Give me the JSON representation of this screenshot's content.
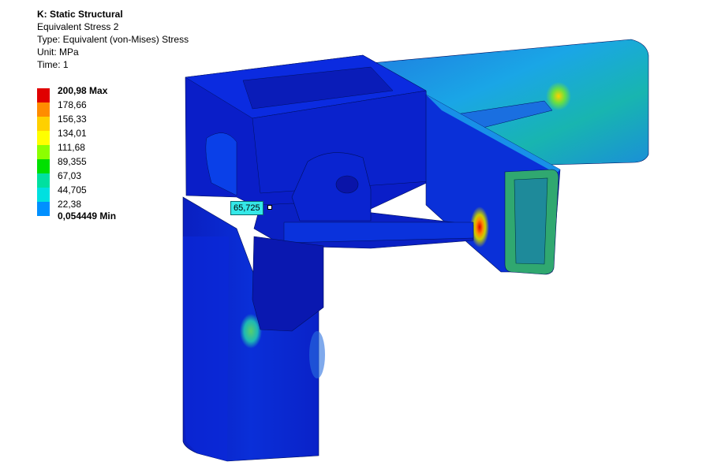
{
  "header": {
    "system": "K: Static Structural",
    "result_name": "Equivalent Stress 2",
    "type": "Type: Equivalent (von-Mises) Stress",
    "unit": "Unit: MPa",
    "time": "Time: 1"
  },
  "legend": {
    "entries": [
      {
        "label": "200,98 Max",
        "color": "#e00000",
        "bold": true
      },
      {
        "label": "178,66",
        "color": "#ff8c00",
        "bold": false
      },
      {
        "label": "156,33",
        "color": "#ffd000",
        "bold": false
      },
      {
        "label": "134,01",
        "color": "#ffff00",
        "bold": false
      },
      {
        "label": "111,68",
        "color": "#8cff00",
        "bold": false
      },
      {
        "label": "89,355",
        "color": "#00e000",
        "bold": false
      },
      {
        "label": "67,03",
        "color": "#00e0a0",
        "bold": false
      },
      {
        "label": "44,705",
        "color": "#00e0e0",
        "bold": false
      },
      {
        "label": "22,38",
        "color": "#0090ff",
        "bold": false
      },
      {
        "label": "0,054449 Min",
        "color": "#0000d0",
        "bold": true
      }
    ]
  },
  "probe": {
    "value": "65,725"
  }
}
